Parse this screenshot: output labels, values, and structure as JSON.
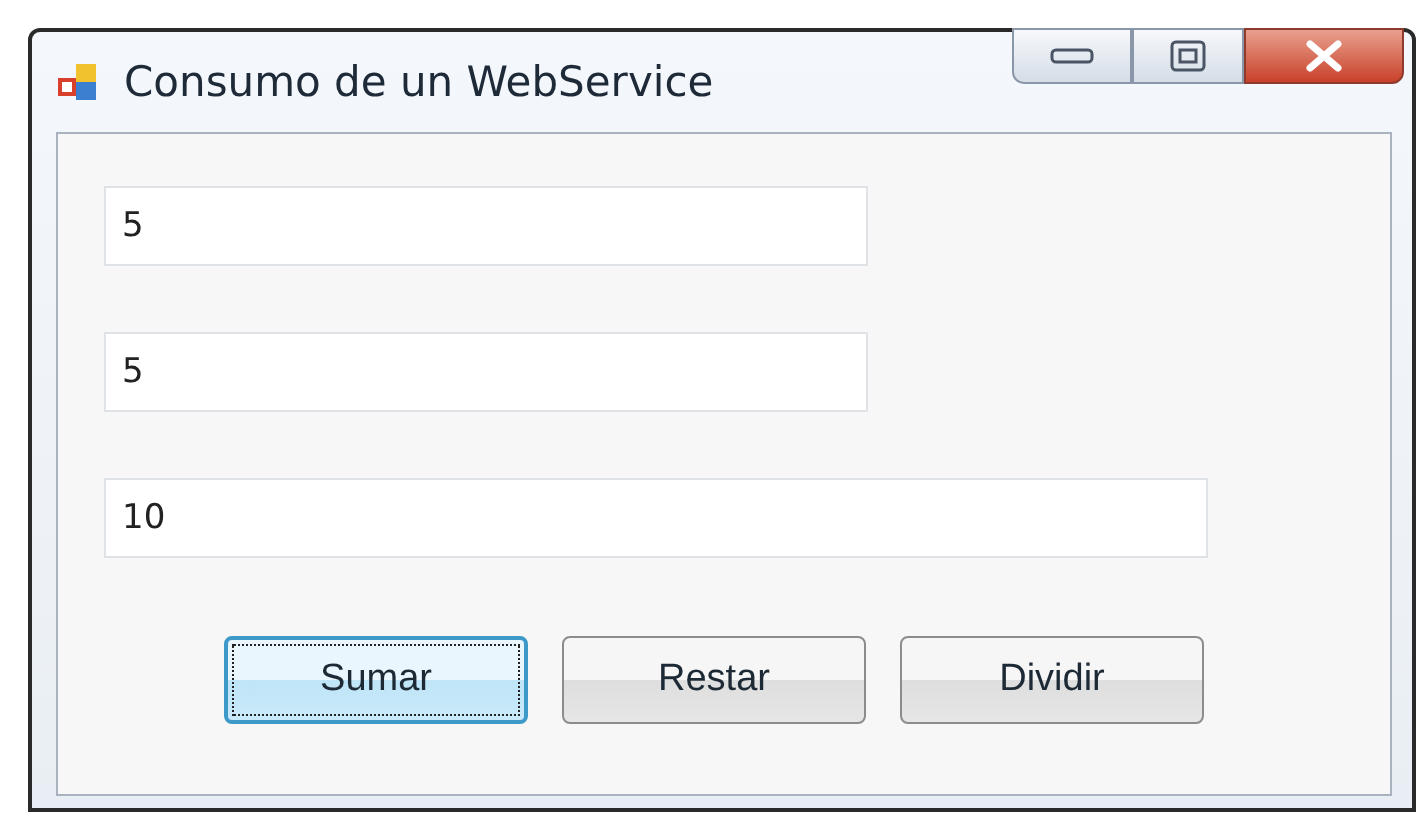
{
  "window": {
    "title": "Consumo de un WebService"
  },
  "fields": [
    {
      "value": "5",
      "wide": false
    },
    {
      "value": "5",
      "wide": false
    },
    {
      "value": "10",
      "wide": true
    }
  ],
  "buttons": [
    {
      "label": "Sumar",
      "focused": true
    },
    {
      "label": "Restar",
      "focused": false
    },
    {
      "label": "Dividir",
      "focused": false
    }
  ]
}
